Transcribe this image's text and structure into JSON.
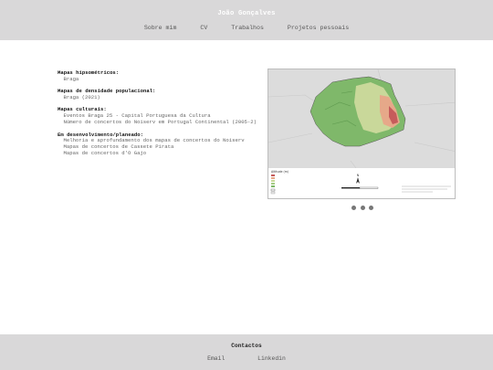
{
  "header": {
    "title": "João Gonçalves",
    "nav": [
      "Sobre mim",
      "CV",
      "Trabalhos",
      "Projetos pessoais"
    ]
  },
  "sections": [
    {
      "heading": "Mapas hipsométricos:",
      "items": [
        "Braga"
      ]
    },
    {
      "heading": "Mapas de densidade populacional:",
      "items": [
        "Braga (2021)"
      ]
    },
    {
      "heading": "Mapas culturais:",
      "items": [
        "Eventos Braga 25 - Capital Portuguesa da Cultura",
        "Número de concertos do Noiserv em Portugal Continental (2005-2)"
      ]
    },
    {
      "heading": "Em desenvolvimento/planeado:",
      "items": [
        "Melhoria e aprofundamento dos mapas de concertos do Noiserv",
        "Mapas de concertos de Cassete Pirata",
        "Mapas de concertos d'O Gajo"
      ]
    }
  ],
  "map_preview": {
    "legend_title": "Altitude (m)",
    "north_label": "N",
    "colors": {
      "low": "#7fb86a",
      "mid": "#c9d89a",
      "high": "#e6a889",
      "peak": "#c65b5b",
      "background": "#dcdcdc"
    }
  },
  "carousel": {
    "dot_count": 3
  },
  "footer": {
    "title": "Contactos",
    "links": [
      "Email",
      "Linkedin"
    ]
  }
}
